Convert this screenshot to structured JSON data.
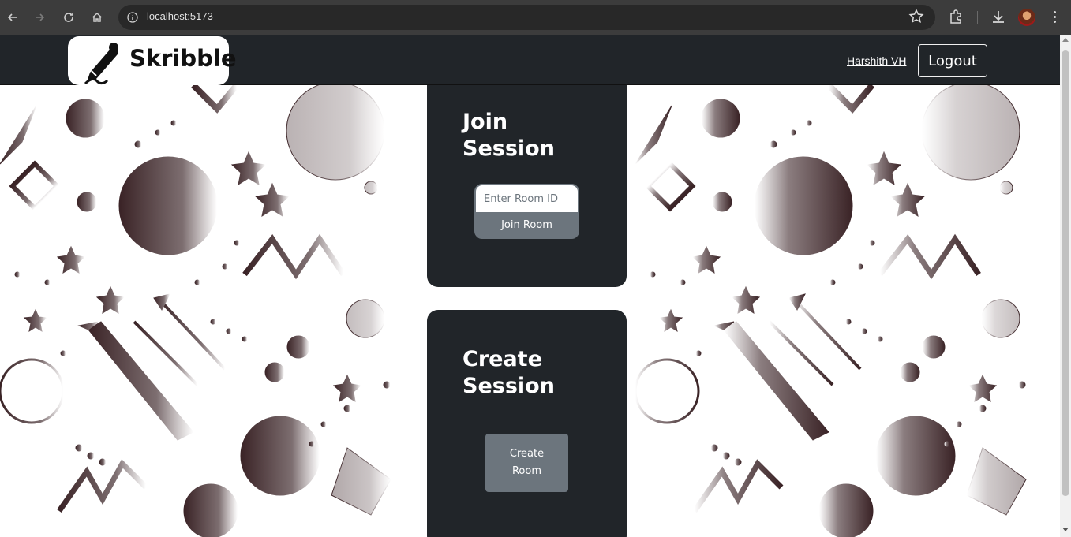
{
  "browser": {
    "url": "localhost:5173",
    "icons": [
      "back-icon",
      "forward-icon",
      "reload-icon",
      "home-icon",
      "site-info-icon",
      "bookmark-star-icon",
      "extensions-icon",
      "download-icon",
      "profile-avatar",
      "menu-icon"
    ]
  },
  "navbar": {
    "brand_name": "Skribble",
    "brand_icon": "pen-icon",
    "user_name": "Harshith VH",
    "logout_label": "Logout"
  },
  "join_card": {
    "title": "Join Session",
    "input_placeholder": "Enter Room ID",
    "input_value": "",
    "button_label": "Join Room"
  },
  "create_card": {
    "title": "Create Session",
    "button_label": "Create Room"
  },
  "colors": {
    "navbar_bg": "#212529",
    "card_bg": "#212529",
    "button_gray": "#6c757d",
    "doodle_color": "#3a2326"
  }
}
